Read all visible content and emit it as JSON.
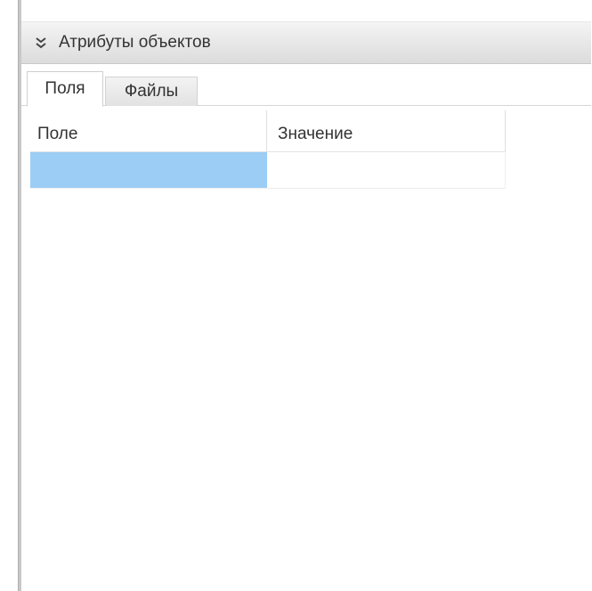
{
  "panel": {
    "title": "Атрибуты объектов",
    "collapse_icon": "double-chevron-down-icon"
  },
  "tabs": [
    {
      "label": "Поля",
      "active": true
    },
    {
      "label": "Файлы",
      "active": false
    }
  ],
  "grid": {
    "columns": [
      "Поле",
      "Значение"
    ],
    "rows": [
      {
        "field": "",
        "value": "",
        "selected": true
      }
    ]
  },
  "colors": {
    "selection": "#9bcdf5",
    "titlebar": "#e6e6e6"
  }
}
